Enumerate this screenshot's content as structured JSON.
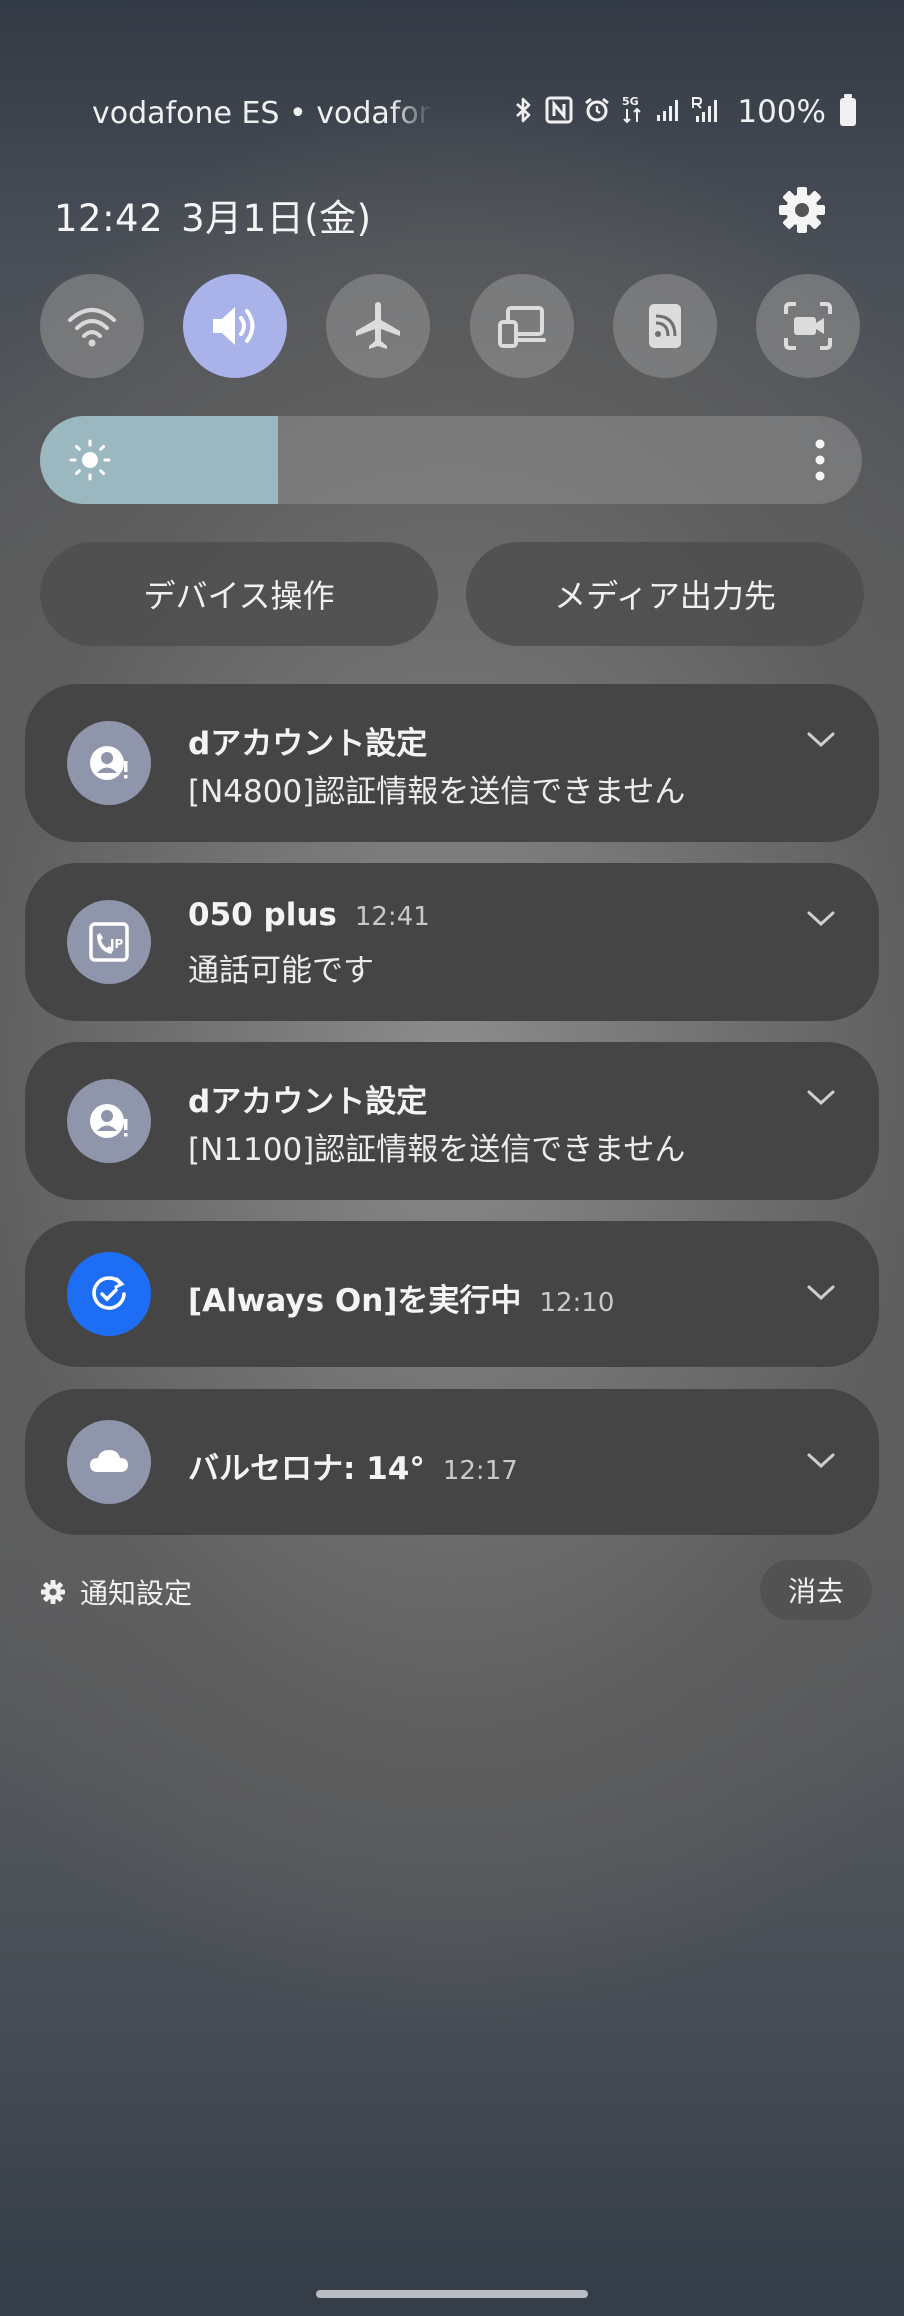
{
  "status_bar": {
    "carrier": "vodafone ES • vodafone ES",
    "network_label": "5G",
    "battery": "100%",
    "icons": [
      "bluetooth-icon",
      "nfc-icon",
      "alarm-icon",
      "data-arrows-icon",
      "signal-icon",
      "roaming-signal-icon",
      "battery-icon"
    ]
  },
  "header": {
    "time": "12:42",
    "date": "3月1日(金)"
  },
  "quick_tiles": [
    {
      "name": "wifi",
      "icon": "wifi-icon",
      "active": false
    },
    {
      "name": "sound",
      "icon": "speaker-icon",
      "active": true
    },
    {
      "name": "airplane",
      "icon": "airplane-icon",
      "active": false
    },
    {
      "name": "device-control",
      "icon": "devices-icon",
      "active": false
    },
    {
      "name": "smart-view",
      "icon": "cast-icon",
      "active": false
    },
    {
      "name": "screen-record",
      "icon": "screen-record-icon",
      "active": false
    }
  ],
  "brightness": {
    "level": 0.29
  },
  "buttons": {
    "device_control": "デバイス操作",
    "media_output": "メディア出力先"
  },
  "notifications": [
    {
      "title": "dアカウント設定",
      "time": "",
      "body": "[N4800]認証情報を送信できません",
      "icon": "account-alert-icon"
    },
    {
      "title": "050 plus",
      "time": "12:41",
      "body": "通話可能です",
      "icon": "ip-phone-icon"
    },
    {
      "title": "dアカウント設定",
      "time": "",
      "body": "[N1100]認証情報を送信できません",
      "icon": "account-alert-icon"
    },
    {
      "title": "[Always On]を実行中",
      "time": "12:10",
      "body": "",
      "icon": "always-on-icon"
    },
    {
      "title": "バルセロナ: 14°",
      "time": "12:17",
      "body": "",
      "icon": "cloud-icon"
    }
  ],
  "footer": {
    "notification_settings": "通知設定",
    "clear": "消去"
  },
  "colors": {
    "active_tile": "#a9b3ea",
    "brightness_fill": "#9bb8c1",
    "card_bg": "#454545",
    "always_on_icon_bg": "#1e6ef5"
  }
}
